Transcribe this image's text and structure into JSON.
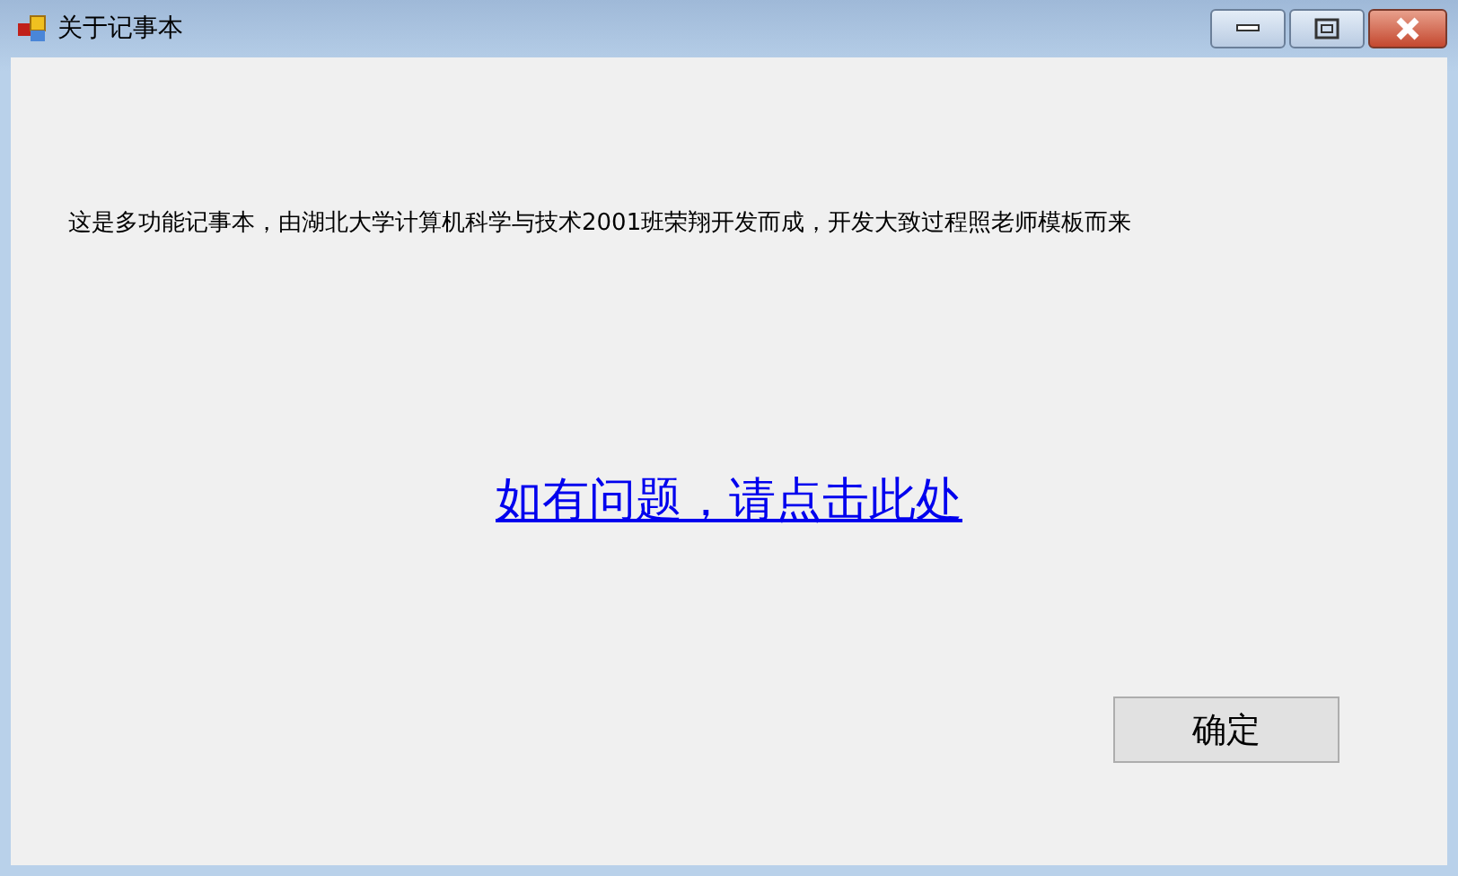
{
  "window": {
    "title": "关于记事本"
  },
  "description": "这是多功能记事本，由湖北大学计算机科学与技术2001班荣翔开发而成，开发大致过程照老师模板而来",
  "link": "如有问题，请点击此处",
  "buttons": [
    "确定"
  ]
}
